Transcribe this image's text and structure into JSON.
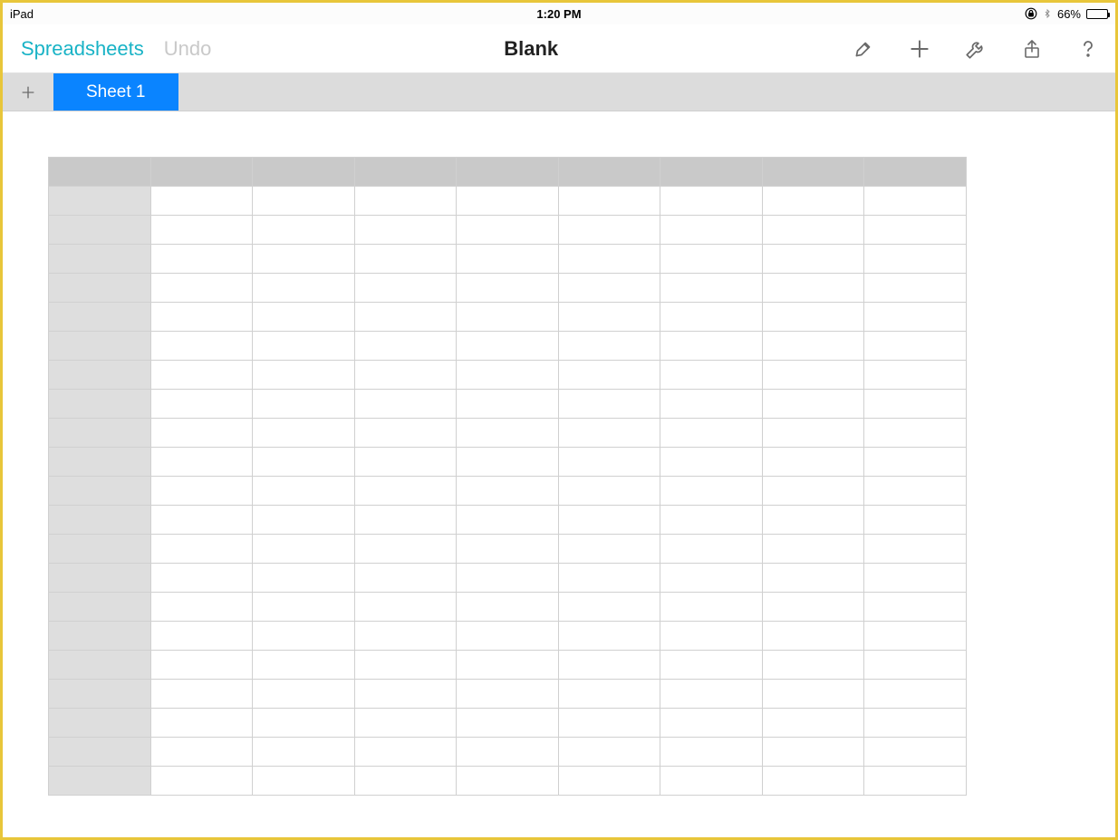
{
  "status": {
    "device": "iPad",
    "time": "1:20 PM",
    "battery_pct": "66%"
  },
  "toolbar": {
    "back_label": "Spreadsheets",
    "undo_label": "Undo",
    "title": "Blank"
  },
  "tabs": {
    "active_label": "Sheet 1"
  },
  "grid": {
    "cols": 8,
    "rows": 21
  }
}
